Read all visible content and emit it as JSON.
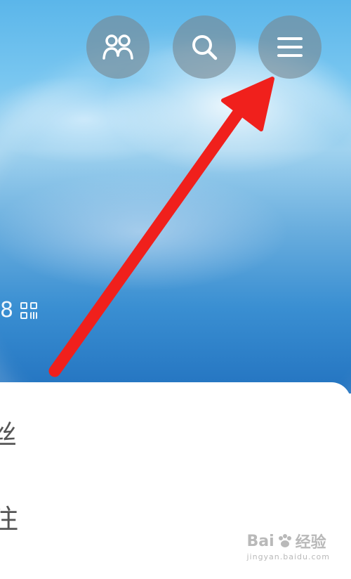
{
  "header": {
    "friends_icon": "friends-icon",
    "search_icon": "search-icon",
    "menu_icon": "menu-icon"
  },
  "profile": {
    "partial_number": "8",
    "qr_icon": "qr-code-icon"
  },
  "card": {
    "line1": "丝",
    "line2": "注"
  },
  "annotation": {
    "arrow_color": "#f0201c"
  },
  "watermark": {
    "brand_a": "Bai",
    "brand_b": "经验",
    "url": "jingyan.baidu.com"
  },
  "colors": {
    "button_bg": "#7c8891",
    "card_bg": "#ffffff"
  }
}
